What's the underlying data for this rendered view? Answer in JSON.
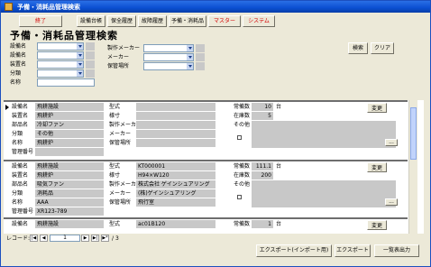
{
  "window": {
    "title": "予備・消耗品管理検索"
  },
  "toolbar": {
    "close": "終了",
    "equipment": "設備台帳",
    "maintenance": "保全履歴",
    "failure": "故障履歴",
    "spare_parts": "予備・消耗品",
    "master": "マスター",
    "system": "システム"
  },
  "heading": "予備・消耗品管理検索",
  "search": {
    "labels": {
      "equipment": "設備名",
      "device": "設備名",
      "unit": "装置名",
      "category": "分類",
      "name": "名称",
      "maker": "製作メーカー",
      "vendor": "メーカー",
      "location": "保管場所"
    },
    "search_btn": "検索",
    "clear_btn": "クリア"
  },
  "labels": {
    "equip": "設備名",
    "unit": "装置名",
    "part": "部品名",
    "category": "分類",
    "name": "名称",
    "mgmt_no": "管理番号",
    "model": "型式",
    "spec": "様寸",
    "maker": "製作メーカー",
    "vendor": "メーカー",
    "location": "保管場所",
    "stock_qty": "常備数",
    "stock": "在庫数",
    "other": "その他",
    "change": "変更",
    "unit_word": "台",
    "more": "..."
  },
  "records": [
    {
      "equip": "飛耕施設",
      "unit": "飛耕炉",
      "part": "冷却ファン",
      "category": "その他",
      "name": "飛耕炉",
      "mgmt_no": "",
      "model": "",
      "spec": "",
      "maker": "",
      "vendor": "",
      "location": "",
      "stock_qty": "10",
      "stock": "5"
    },
    {
      "equip": "飛耕施設",
      "unit": "飛耕炉",
      "part": "吸気ファン",
      "category": "消耗品",
      "name": "AAA",
      "mgmt_no": "XR123-789",
      "model": "KT000001",
      "spec": "H94×W120",
      "maker": "株式会社 ゲインシュアリング",
      "vendor": "(株)ゲインシュアリング",
      "location": "飛行室",
      "stock_qty": "111.1",
      "stock": "200"
    },
    {
      "equip": "飛耕施設",
      "unit": "",
      "part": "",
      "category": "",
      "name": "",
      "mgmt_no": "",
      "model": "ac01B120",
      "spec": "",
      "maker": "",
      "vendor": "",
      "location": "",
      "stock_qty": "1",
      "stock": ""
    }
  ],
  "nav": {
    "label": "レコード:",
    "current": "1",
    "total": "3",
    "of": "/"
  },
  "footer": {
    "export_import": "エクスポート(インポート用)",
    "export": "エクスポート",
    "list_print": "一覧表出力"
  }
}
